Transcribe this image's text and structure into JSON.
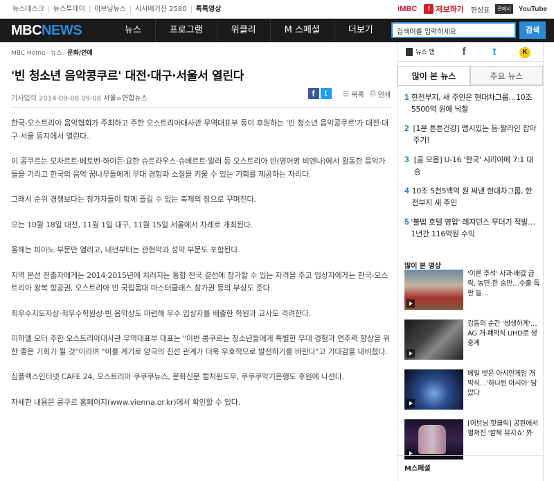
{
  "topbar": {
    "links": [
      "뉴스데스크",
      "뉴스투데이",
      "이브닝뉴스",
      "시사매거진 2580",
      "톡톡영상"
    ],
    "imbc": "iMBC",
    "report": "제보하기",
    "report_icon": "megaphone-icon",
    "paper": "편성표",
    "badge": "관에서",
    "youtube": "YouTube"
  },
  "nav": {
    "logo_mbc": "MBC",
    "logo_news": "NEWS",
    "menu": [
      "뉴스",
      "프로그램",
      "위클리",
      "M 스페셜",
      "더보기"
    ],
    "search_value": "검색어를 입력하세요",
    "search_button": "검색"
  },
  "breadcrumb": {
    "home": "MBC Home",
    "section": "뉴스",
    "current": "문화/연예"
  },
  "article": {
    "title": "'빈 청소년 음악콩쿠르' 대전·대구·서울서 열린다",
    "date": "기사입력 2014-09-08 09:08",
    "source": "서울=연합뉴스",
    "list_label": "목록",
    "print_label": "인쇄",
    "paragraphs": [
      "한국-오스트리아 음악협회가 주최하고 주한 오스트리아대사관 무역대표부 등이 후원하는 '빈 청소년 음악콩쿠르'가 대전·대구·서울 등지에서 열린다.",
      "이 콩쿠르는 모차르트·베토벤·하이든·요한 슈트라우스·슈베르트·말러 등 오스트리아 빈(영어명 비엔나)에서 활동한 음악가들을 기리고 한국의 음악 꿈나무들에게 무대 경험과 소질을 키울 수 있는 기회를 제공하는 자리다.",
      "그래서 순위 경쟁보다는 참가자들이 함께 즐길 수 있는 축제의 장으로 꾸며진다.",
      "오는 10월 18일 대전, 11월 1일 대구, 11월 15일 서울에서 차례로 개최된다.",
      "올해는 피아노 부문만 열리고, 내년부터는 관현악과 성악 부문도 포함된다.",
      "지역 본선 진출자에게는 2014·2015년에 치러지는 통합 전국 결선에 참가할 수 있는 자격을 주고 입상자에게는 한국-오스트리아 왕복 항공권, 오스트리아 빈 국립음대 마스터클래스 참가권 등의 부상도 준다.",
      "최우수지도자상·최우수학원상·빈 음악상도 마련해 우수 입상자를 배출한 학원과 교사도 격려한다.",
      "미하엘 오터 주한 오스트리아대사관 무역대표부 대표는 \"이번 콩쿠르는 청소년들에게 특별한 무대 경험과 연주력 향상을 위한 좋은 기회가 될 것\"이라며 \"이를 계기로 양국의 친선 관계가 더욱 우호적으로 발전하기를 바란다\"고 기대감을 내비쳤다.",
      "심플렉스인터넷 CAFE 24, 오스트리아 쿠쿠쿠뉴스, 문화신문 컬처윈도우, 쿠쿠쿠악기은행도 후원에 나선다.",
      "자세한 내용은 콩쿠르 홈페이지(www.vienna.or.kr)에서 확인할 수 있다."
    ]
  },
  "sidebar": {
    "app_label": "뉴스 앱",
    "social_icons": [
      "facebook-icon",
      "twitter-icon",
      "kakaostory-icon"
    ],
    "tab_popular": "많이 본 뉴스",
    "tab_main": "주요 뉴스",
    "ranking": [
      {
        "num": "1",
        "text": "한전부지, 새 주인은 현대차그룹…10조 5500억 원에 낙찰"
      },
      {
        "num": "2",
        "text": "[1분 튼튼건강] 맵시있는 등·팔라인 잡아주기!"
      },
      {
        "num": "3",
        "text": "[골 모음] U-16 '한국' 시리아에 7:1 대승"
      },
      {
        "num": "4",
        "text": "10조 5천5백억 원 써낸 현대차그룹, 한전부지 새 주인"
      },
      {
        "num": "5",
        "text": "'불법 호텔 영업' 레지던스 무더기 적발…1년간 116억원 수익"
      }
    ],
    "video_heading": "많이 본 영상",
    "videos": [
      {
        "text": "'이른 추석' 사과·배값 급락, 농민 한 숨만…수출·특판 늘…"
      },
      {
        "text": "감동의 순간 '생생하게'…AG 개·폐막식 UHD로 생중계"
      },
      {
        "text": "베일 벗은 아시안게임 개막식…'하나된 아시아' 담았다"
      },
      {
        "text": "[이브닝 핫클릭] 공원에서 펼쳐진 '깜짝 뮤지쇼' 外"
      }
    ],
    "mspecial": "M스페셜"
  }
}
